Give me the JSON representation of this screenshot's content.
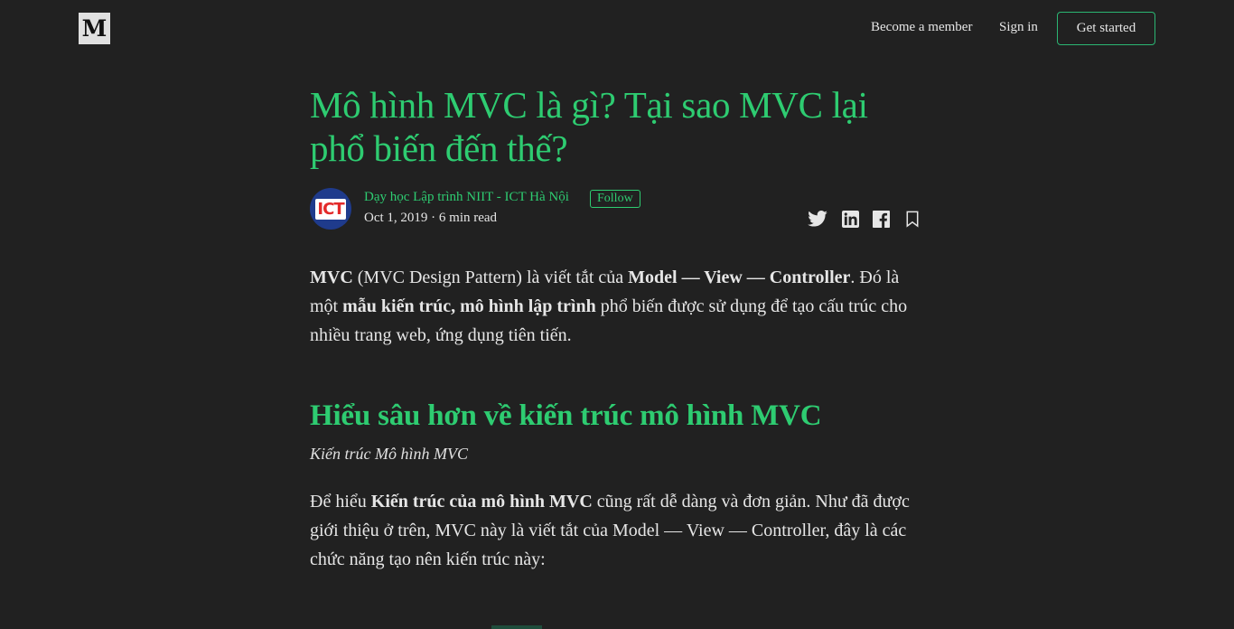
{
  "header": {
    "logo": "M",
    "become_member": "Become a member",
    "sign_in": "Sign in",
    "get_started": "Get started"
  },
  "article": {
    "title": "Mô hình MVC là gì? Tại sao MVC lại phổ biến đến thế?",
    "author": {
      "avatar_text": "ICT",
      "name": "Dạy học Lập trình NIIT - ICT Hà Nội",
      "follow": "Follow",
      "meta": "Oct 1, 2019 · 6 min read"
    },
    "share_icons": [
      "twitter-icon",
      "linkedin-icon",
      "facebook-icon",
      "bookmark-icon"
    ],
    "p1": {
      "s1": "MVC",
      "s2": " (MVC Design Pattern) là viết tắt của ",
      "s3": "Model — View — Controller",
      "s4": ". Đó là một ",
      "s5": "mẫu kiến trúc, mô hình lập trình",
      "s6": " phổ biến được sử dụng để tạo cấu trúc cho nhiều trang web, ứng dụng tiên tiến."
    },
    "heading": "Hiểu sâu hơn về kiến trúc mô hình MVC",
    "caption": "Kiến trúc Mô hình MVC",
    "p2": {
      "s1": "Để hiểu ",
      "s2": "Kiến trúc của mô hình MVC",
      "s3": " cũng rất dễ dàng và đơn giản. Như đã được giới thiệu ở trên, MVC này là viết tắt của Model — View — Controller, đây là các chức năng tạo nên kiến trúc này:"
    }
  },
  "colors": {
    "background": "#212121",
    "accent": "#2ecc71",
    "text": "#e6e6e6"
  }
}
